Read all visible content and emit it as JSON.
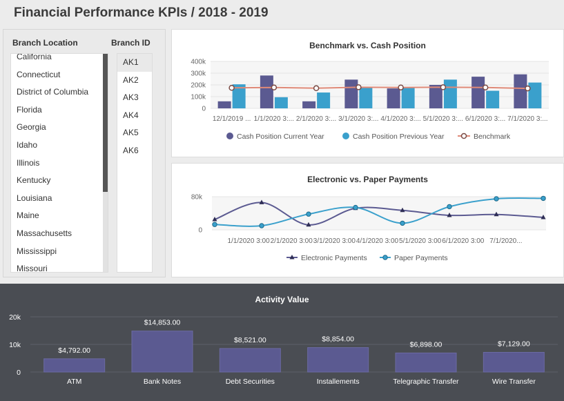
{
  "page": {
    "title": "Financial Performance KPIs / 2018 - 2019"
  },
  "filters": {
    "location_header": "Branch Location",
    "id_header": "Branch ID",
    "locations": [
      "California",
      "Connecticut",
      "District of Columbia",
      "Florida",
      "Georgia",
      "Idaho",
      "Illinois",
      "Kentucky",
      "Louisiana",
      "Maine",
      "Massachusetts",
      "Mississippi",
      "Missouri"
    ],
    "ids": [
      "AK1",
      "AK2",
      "AK3",
      "AK4",
      "AK5",
      "AK6"
    ],
    "selected_id": "AK1"
  },
  "colors": {
    "current": "#5b5a91",
    "previous": "#3aa0cc",
    "benchmark": "#e08a78",
    "electronic": "#5b5a91",
    "paper": "#3aa0cc",
    "activity": "#5b5a91"
  },
  "chart_data": [
    {
      "type": "bar",
      "title": "Benchmark vs. Cash Position",
      "categories": [
        "12/1/2019 ...",
        "1/1/2020 3:...",
        "2/1/2020 3:...",
        "3/1/2020 3:...",
        "4/1/2020 3:...",
        "5/1/2020 3:...",
        "6/1/2020 3:...",
        "7/1/2020 3:..."
      ],
      "yticks": [
        "400k",
        "300k",
        "200k",
        "100k",
        "0"
      ],
      "ylim": [
        0,
        400000
      ],
      "series": [
        {
          "name": "Cash Position Current Year",
          "kind": "bar",
          "values": [
            60000,
            280000,
            60000,
            245000,
            170000,
            200000,
            270000,
            290000
          ]
        },
        {
          "name": "Cash Position Previous Year",
          "kind": "bar",
          "values": [
            205000,
            95000,
            135000,
            180000,
            180000,
            245000,
            150000,
            220000
          ]
        },
        {
          "name": "Benchmark",
          "kind": "line",
          "values": [
            175000,
            178000,
            172000,
            180000,
            178000,
            180000,
            178000,
            170000
          ]
        }
      ],
      "legend": "bottom"
    },
    {
      "type": "line",
      "title": "Electronic vs. Paper Payments",
      "categories": [
        "1/1/2020 3:00",
        "2/1/2020 3:00",
        "3/1/2020 3:00",
        "4/1/2020 3:00",
        "5/1/2020 3:00",
        "6/1/2020 3:00",
        "7/1/2020..."
      ],
      "yticks": [
        "80k",
        "0"
      ],
      "ylim": [
        0,
        80000
      ],
      "series": [
        {
          "name": "Electronic Payments",
          "values": [
            25000,
            66000,
            12000,
            52000,
            47000,
            35000,
            37000,
            30000
          ]
        },
        {
          "name": "Paper Payments",
          "values": [
            13000,
            10000,
            38000,
            54000,
            16000,
            56000,
            75000,
            76000
          ]
        }
      ],
      "legend": "bottom"
    },
    {
      "type": "bar",
      "title": "Activity Value",
      "categories": [
        "ATM",
        "Bank Notes",
        "Debt Securities",
        "Installements",
        "Telegraphic Transfer",
        "Wire Transfer"
      ],
      "values": [
        4792,
        14853,
        8521,
        8854,
        6898,
        7129
      ],
      "labels": [
        "$4,792.00",
        "$14,853.00",
        "$8,521.00",
        "$8,854.00",
        "$6,898.00",
        "$7,129.00"
      ],
      "yticks": [
        "20k",
        "10k",
        "0"
      ],
      "ylim": [
        0,
        20000
      ]
    }
  ]
}
